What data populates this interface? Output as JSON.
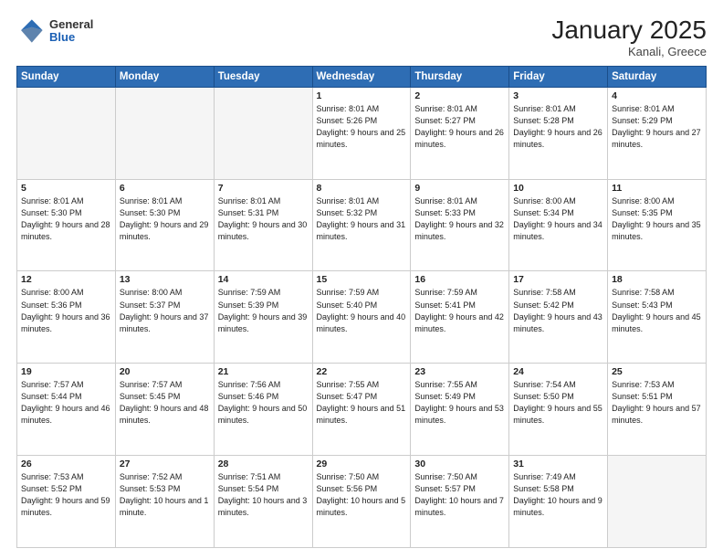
{
  "header": {
    "logo_general": "General",
    "logo_blue": "Blue",
    "month_title": "January 2025",
    "subtitle": "Kanali, Greece"
  },
  "weekdays": [
    "Sunday",
    "Monday",
    "Tuesday",
    "Wednesday",
    "Thursday",
    "Friday",
    "Saturday"
  ],
  "weeks": [
    [
      {
        "day": "",
        "info": ""
      },
      {
        "day": "",
        "info": ""
      },
      {
        "day": "",
        "info": ""
      },
      {
        "day": "1",
        "info": "Sunrise: 8:01 AM\nSunset: 5:26 PM\nDaylight: 9 hours\nand 25 minutes."
      },
      {
        "day": "2",
        "info": "Sunrise: 8:01 AM\nSunset: 5:27 PM\nDaylight: 9 hours\nand 26 minutes."
      },
      {
        "day": "3",
        "info": "Sunrise: 8:01 AM\nSunset: 5:28 PM\nDaylight: 9 hours\nand 26 minutes."
      },
      {
        "day": "4",
        "info": "Sunrise: 8:01 AM\nSunset: 5:29 PM\nDaylight: 9 hours\nand 27 minutes."
      }
    ],
    [
      {
        "day": "5",
        "info": "Sunrise: 8:01 AM\nSunset: 5:30 PM\nDaylight: 9 hours\nand 28 minutes."
      },
      {
        "day": "6",
        "info": "Sunrise: 8:01 AM\nSunset: 5:30 PM\nDaylight: 9 hours\nand 29 minutes."
      },
      {
        "day": "7",
        "info": "Sunrise: 8:01 AM\nSunset: 5:31 PM\nDaylight: 9 hours\nand 30 minutes."
      },
      {
        "day": "8",
        "info": "Sunrise: 8:01 AM\nSunset: 5:32 PM\nDaylight: 9 hours\nand 31 minutes."
      },
      {
        "day": "9",
        "info": "Sunrise: 8:01 AM\nSunset: 5:33 PM\nDaylight: 9 hours\nand 32 minutes."
      },
      {
        "day": "10",
        "info": "Sunrise: 8:00 AM\nSunset: 5:34 PM\nDaylight: 9 hours\nand 34 minutes."
      },
      {
        "day": "11",
        "info": "Sunrise: 8:00 AM\nSunset: 5:35 PM\nDaylight: 9 hours\nand 35 minutes."
      }
    ],
    [
      {
        "day": "12",
        "info": "Sunrise: 8:00 AM\nSunset: 5:36 PM\nDaylight: 9 hours\nand 36 minutes."
      },
      {
        "day": "13",
        "info": "Sunrise: 8:00 AM\nSunset: 5:37 PM\nDaylight: 9 hours\nand 37 minutes."
      },
      {
        "day": "14",
        "info": "Sunrise: 7:59 AM\nSunset: 5:39 PM\nDaylight: 9 hours\nand 39 minutes."
      },
      {
        "day": "15",
        "info": "Sunrise: 7:59 AM\nSunset: 5:40 PM\nDaylight: 9 hours\nand 40 minutes."
      },
      {
        "day": "16",
        "info": "Sunrise: 7:59 AM\nSunset: 5:41 PM\nDaylight: 9 hours\nand 42 minutes."
      },
      {
        "day": "17",
        "info": "Sunrise: 7:58 AM\nSunset: 5:42 PM\nDaylight: 9 hours\nand 43 minutes."
      },
      {
        "day": "18",
        "info": "Sunrise: 7:58 AM\nSunset: 5:43 PM\nDaylight: 9 hours\nand 45 minutes."
      }
    ],
    [
      {
        "day": "19",
        "info": "Sunrise: 7:57 AM\nSunset: 5:44 PM\nDaylight: 9 hours\nand 46 minutes."
      },
      {
        "day": "20",
        "info": "Sunrise: 7:57 AM\nSunset: 5:45 PM\nDaylight: 9 hours\nand 48 minutes."
      },
      {
        "day": "21",
        "info": "Sunrise: 7:56 AM\nSunset: 5:46 PM\nDaylight: 9 hours\nand 50 minutes."
      },
      {
        "day": "22",
        "info": "Sunrise: 7:55 AM\nSunset: 5:47 PM\nDaylight: 9 hours\nand 51 minutes."
      },
      {
        "day": "23",
        "info": "Sunrise: 7:55 AM\nSunset: 5:49 PM\nDaylight: 9 hours\nand 53 minutes."
      },
      {
        "day": "24",
        "info": "Sunrise: 7:54 AM\nSunset: 5:50 PM\nDaylight: 9 hours\nand 55 minutes."
      },
      {
        "day": "25",
        "info": "Sunrise: 7:53 AM\nSunset: 5:51 PM\nDaylight: 9 hours\nand 57 minutes."
      }
    ],
    [
      {
        "day": "26",
        "info": "Sunrise: 7:53 AM\nSunset: 5:52 PM\nDaylight: 9 hours\nand 59 minutes."
      },
      {
        "day": "27",
        "info": "Sunrise: 7:52 AM\nSunset: 5:53 PM\nDaylight: 10 hours\nand 1 minute."
      },
      {
        "day": "28",
        "info": "Sunrise: 7:51 AM\nSunset: 5:54 PM\nDaylight: 10 hours\nand 3 minutes."
      },
      {
        "day": "29",
        "info": "Sunrise: 7:50 AM\nSunset: 5:56 PM\nDaylight: 10 hours\nand 5 minutes."
      },
      {
        "day": "30",
        "info": "Sunrise: 7:50 AM\nSunset: 5:57 PM\nDaylight: 10 hours\nand 7 minutes."
      },
      {
        "day": "31",
        "info": "Sunrise: 7:49 AM\nSunset: 5:58 PM\nDaylight: 10 hours\nand 9 minutes."
      },
      {
        "day": "",
        "info": ""
      }
    ]
  ]
}
